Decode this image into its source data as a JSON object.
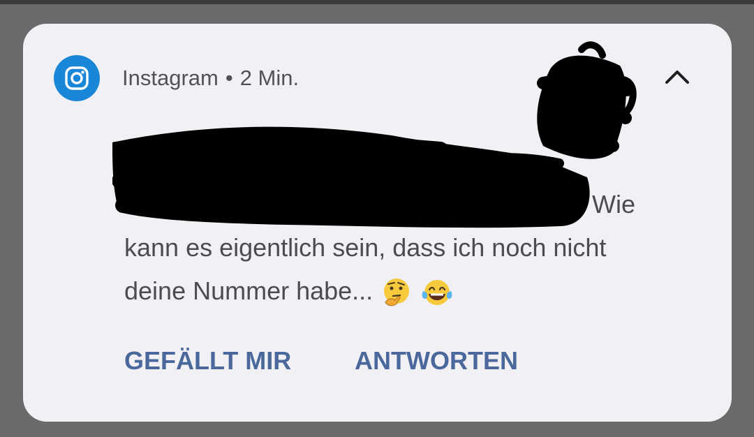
{
  "notification": {
    "app_name": "Instagram",
    "separator": "•",
    "time": "2 Min.",
    "icon": "instagram-icon",
    "brand_color": "#1a86d8",
    "message_line1_visible": "Wie",
    "message_line2": "kann es eigentlich sein, dass ich noch nicht",
    "message_line3": "deine Nummer habe...",
    "emojis": [
      "thinking-face-emoji",
      "tears-of-joy-emoji"
    ],
    "redacted": true
  },
  "actions": {
    "like_label": "GEFÄLLT MIR",
    "reply_label": "ANTWORTEN",
    "color": "#4a689b"
  },
  "controls": {
    "collapse_icon": "chevron-up-icon"
  }
}
